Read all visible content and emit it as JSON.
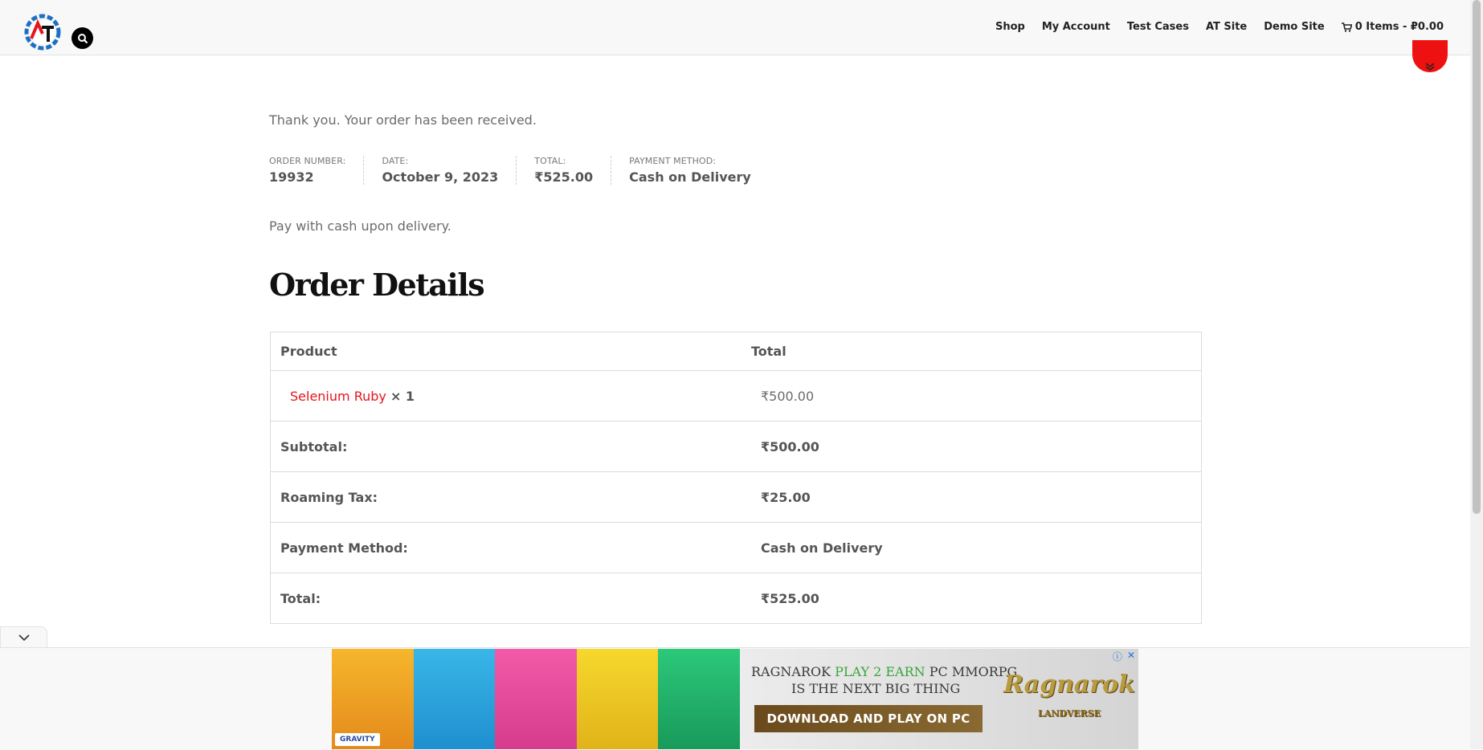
{
  "header": {
    "nav": [
      "Shop",
      "My Account",
      "Test Cases",
      "AT Site",
      "Demo Site"
    ],
    "cart_label": "0 Items - ₽0.00",
    "logo_letters": "AT"
  },
  "content": {
    "thank_you": "Thank you. Your order has been received.",
    "overview": {
      "order_number_label": "ORDER NUMBER:",
      "order_number": "19932",
      "date_label": "DATE:",
      "date": "October 9, 2023",
      "total_label": "TOTAL:",
      "total": "₹525.00",
      "payment_label": "PAYMENT METHOD:",
      "payment": "Cash on Delivery"
    },
    "payment_note": "Pay with cash upon delivery.",
    "section_title": "Order Details",
    "table": {
      "col_product": "Product",
      "col_total": "Total",
      "item_name": "Selenium Ruby",
      "item_qty": "× 1",
      "item_price": "₹500.00",
      "rows": [
        {
          "label": "Subtotal:",
          "value": "₹500.00"
        },
        {
          "label": "Roaming Tax:",
          "value": "₹25.00"
        },
        {
          "label": "Payment Method:",
          "value": "Cash on Delivery"
        },
        {
          "label": "Total:",
          "value": "₹525.00"
        }
      ]
    }
  },
  "ad": {
    "headline_1a": "RAGNAROK ",
    "headline_1b": "PLAY 2 EARN",
    "headline_1c": " PC MMORPG",
    "headline_2": "IS THE NEXT BIG THING",
    "cta": "DOWNLOAD AND PLAY ON PC",
    "brand": "Ragnarok",
    "sub_brand": "LANDVERSE",
    "publisher": "GRAVITY"
  },
  "colors": {
    "accent": "#e8131e",
    "scroll_button": "#ee1111"
  }
}
